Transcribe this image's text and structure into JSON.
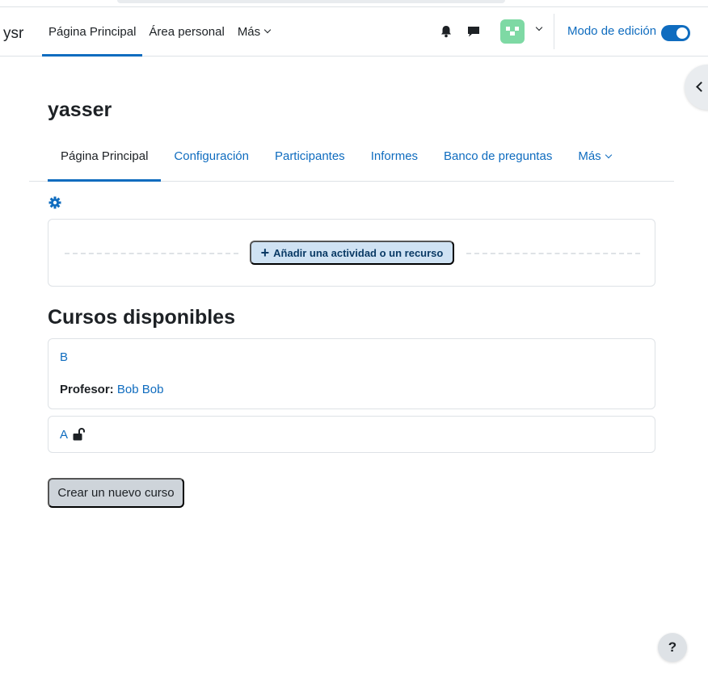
{
  "header": {
    "brand": "ysr",
    "nav": [
      {
        "label": "Página Principal",
        "active": true
      },
      {
        "label": "Área personal",
        "active": false
      },
      {
        "label": "Más",
        "active": false
      }
    ],
    "edit_mode_label": "Modo de edición",
    "edit_mode_on": true,
    "avatar_color": "#7ed9a4"
  },
  "page": {
    "title": "yasser",
    "secondary_nav": [
      {
        "label": "Página Principal",
        "active": true
      },
      {
        "label": "Configuración",
        "active": false
      },
      {
        "label": "Participantes",
        "active": false
      },
      {
        "label": "Informes",
        "active": false
      },
      {
        "label": "Banco de preguntas",
        "active": false
      },
      {
        "label": "Más",
        "active": false
      }
    ],
    "add_activity_label": "Añadir una actividad o un recurso",
    "add_icon": "+"
  },
  "courses": {
    "title": "Cursos disponibles",
    "items": [
      {
        "name": "B",
        "teacher_label": "Profesor:",
        "teacher_name": "Bob Bob"
      },
      {
        "name": "A",
        "locked": false
      }
    ],
    "new_course_label": "Crear un nuevo curso"
  },
  "help": {
    "label": "?"
  },
  "colors": {
    "accent": "#0f6cbf",
    "text": "#1d2125",
    "border": "#dee2e6",
    "add_button_bg": "#cfe2f3",
    "secondary_button_bg": "#ced4da"
  }
}
